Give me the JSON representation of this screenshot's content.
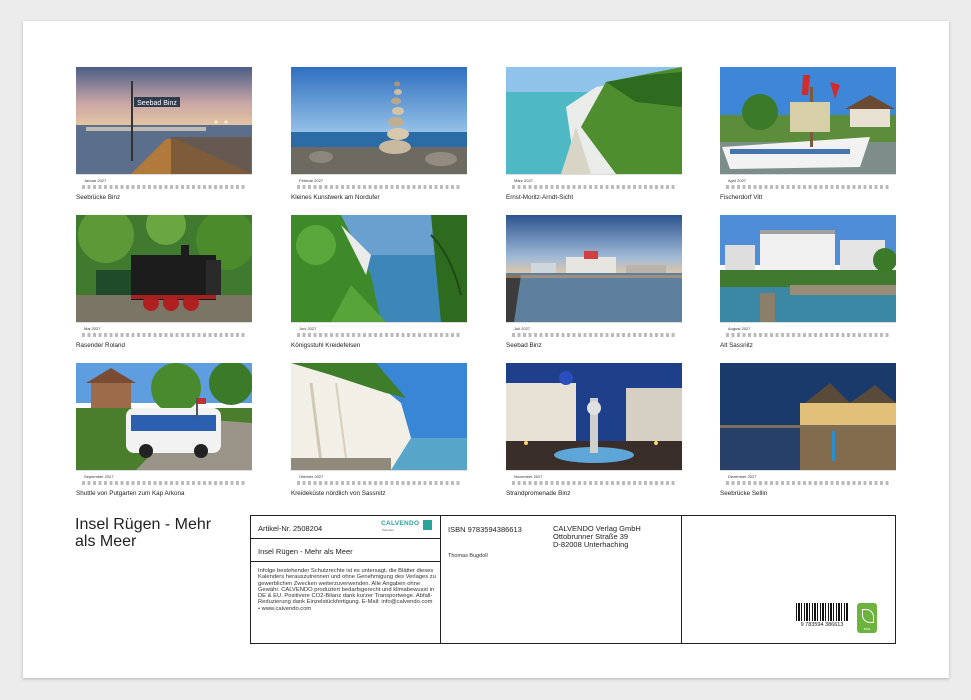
{
  "calendar_title": "Insel Rügen - Mehr als Meer",
  "months": [
    {
      "month": "Januar 2027",
      "caption": "Seebrücke Binz"
    },
    {
      "month": "Februar 2027",
      "caption": "Kleines Kunstwerk am Nordufer"
    },
    {
      "month": "März 2027",
      "caption": "Ernst-Moritz-Arndt-Sicht"
    },
    {
      "month": "April 2027",
      "caption": "Fischerdorf Vitt"
    },
    {
      "month": "Mai 2027",
      "caption": "Rasender Roland"
    },
    {
      "month": "Juni 2027",
      "caption": "Königsstuhl Kreidefelsen"
    },
    {
      "month": "Juli 2027",
      "caption": "Seebad Binz"
    },
    {
      "month": "August 2027",
      "caption": "Alt Sassnitz"
    },
    {
      "month": "September 2027",
      "caption": "Shuttle von Putgarten zum Kap Arkona"
    },
    {
      "month": "Oktober 2027",
      "caption": "Kreideküste nördlich von Sassnitz"
    },
    {
      "month": "November 2027",
      "caption": "Strandpromenade Binz"
    },
    {
      "month": "Dezember 2027",
      "caption": "Seebrücke Sellin"
    }
  ],
  "photo_signs": {
    "january": "Seebad Binz"
  },
  "info": {
    "article_label": "Artikel-Nr. 2508204",
    "brand_name": "CALVENDO",
    "brand_sub": "Kalender",
    "product_title": "Insel Rügen - Mehr als Meer",
    "legal_text": "Infolge bestehender Schutzrechte ist es untersagt, die Blätter dieses Kalenders herauszutrennen und ohne Genehmigung des Verlages zu gewerblichen Zwecken weiterzuverwenden. Alle Angaben ohne Gewähr. CALVENDO produziert bedarfsgerecht und klimabewusst in DE & EU. Positivere CO2-Bilanz dank kurzer Transportwege. Abfall-Reduzierung dank Einzelstückfertigung. E-Mail: info@calvendo.com • www.calvendo.com",
    "isbn": "ISBN 9783594386613",
    "publisher_name": "CALVENDO Verlag GmbH",
    "publisher_street": "Ottobrunner Straße 39",
    "publisher_city": "D-82008 Unterhaching",
    "author": "Thomas Bugdoll",
    "barcode_digits": "9 783594 386613",
    "eco_label": "eco"
  },
  "colors": {
    "sheet": "#ffffff",
    "background": "#ececec",
    "eco_green": "#6db33f",
    "brand_teal": "#2aa39a"
  }
}
